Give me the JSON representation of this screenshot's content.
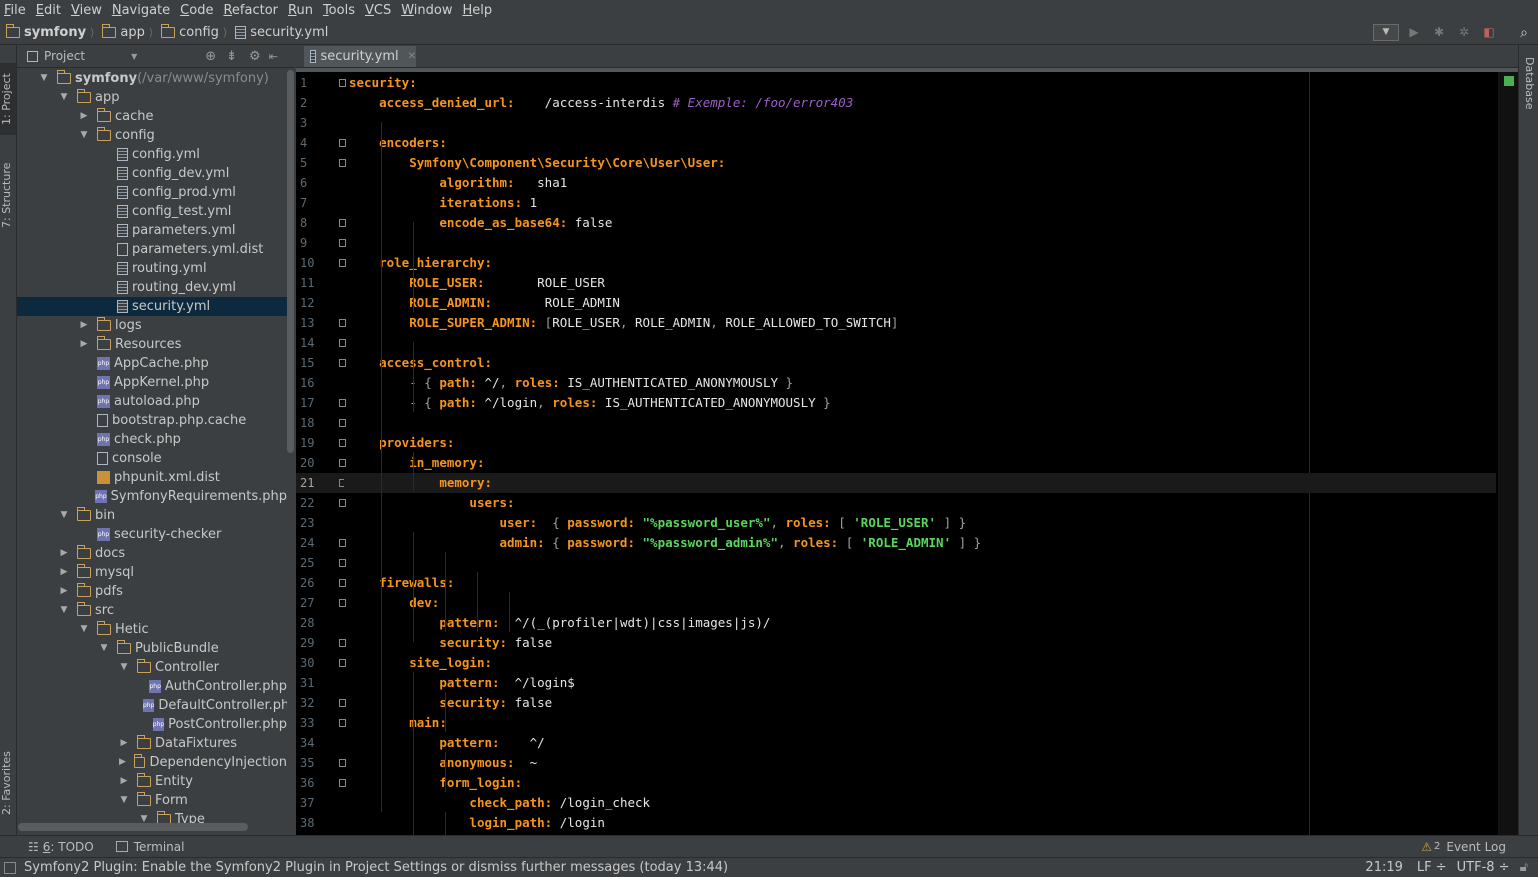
{
  "menu": {
    "items": [
      {
        "u": "F",
        "rest": "ile"
      },
      {
        "u": "E",
        "rest": "dit"
      },
      {
        "u": "V",
        "rest": "iew"
      },
      {
        "u": "N",
        "rest": "avigate"
      },
      {
        "u": "C",
        "rest": "ode"
      },
      {
        "u": "R",
        "rest": "efactor"
      },
      {
        "u": "R",
        "rest": "un"
      },
      {
        "u": "T",
        "rest": "ools"
      },
      {
        "u": "V",
        "rest": "CS"
      },
      {
        "u": "W",
        "rest": "indow"
      },
      {
        "u": "H",
        "rest": "elp"
      }
    ]
  },
  "breadcrumb": [
    "symfony",
    "app",
    "config",
    "security.yml"
  ],
  "left_strip": {
    "project": "1: Project",
    "structure": "7: Structure",
    "favorites": "2: Favorites"
  },
  "right_strip": {
    "database": "Database"
  },
  "project_panel": {
    "title": "Project",
    "tree": [
      {
        "label": "symfony",
        "extra": " (/var/www/symfony)",
        "icon": "folder",
        "arrow": "down",
        "depth": 0,
        "bold": true
      },
      {
        "label": "app",
        "icon": "folder",
        "arrow": "down",
        "depth": 1
      },
      {
        "label": "cache",
        "icon": "folder",
        "arrow": "right",
        "depth": 2
      },
      {
        "label": "config",
        "icon": "folder",
        "arrow": "down",
        "depth": 2
      },
      {
        "label": "config.yml",
        "icon": "yml",
        "depth": 3
      },
      {
        "label": "config_dev.yml",
        "icon": "yml",
        "depth": 3
      },
      {
        "label": "config_prod.yml",
        "icon": "yml",
        "depth": 3
      },
      {
        "label": "config_test.yml",
        "icon": "yml",
        "depth": 3
      },
      {
        "label": "parameters.yml",
        "icon": "yml",
        "depth": 3
      },
      {
        "label": "parameters.yml.dist",
        "icon": "txt",
        "depth": 3
      },
      {
        "label": "routing.yml",
        "icon": "yml",
        "depth": 3
      },
      {
        "label": "routing_dev.yml",
        "icon": "yml",
        "depth": 3
      },
      {
        "label": "security.yml",
        "icon": "yml",
        "depth": 3,
        "selected": true
      },
      {
        "label": "logs",
        "icon": "folder",
        "arrow": "right",
        "depth": 2
      },
      {
        "label": "Resources",
        "icon": "folder",
        "arrow": "right",
        "depth": 2
      },
      {
        "label": "AppCache.php",
        "icon": "php",
        "depth": 2
      },
      {
        "label": "AppKernel.php",
        "icon": "php",
        "depth": 2
      },
      {
        "label": "autoload.php",
        "icon": "php",
        "depth": 2
      },
      {
        "label": "bootstrap.php.cache",
        "icon": "txt",
        "depth": 2
      },
      {
        "label": "check.php",
        "icon": "php",
        "depth": 2
      },
      {
        "label": "console",
        "icon": "txt",
        "depth": 2
      },
      {
        "label": "phpunit.xml.dist",
        "icon": "xml",
        "depth": 2
      },
      {
        "label": "SymfonyRequirements.php",
        "icon": "php",
        "depth": 2
      },
      {
        "label": "bin",
        "icon": "folder",
        "arrow": "down",
        "depth": 1
      },
      {
        "label": "security-checker",
        "icon": "php",
        "depth": 2
      },
      {
        "label": "docs",
        "icon": "folder",
        "arrow": "right",
        "depth": 1
      },
      {
        "label": "mysql",
        "icon": "folder",
        "arrow": "right",
        "depth": 1
      },
      {
        "label": "pdfs",
        "icon": "folder",
        "arrow": "right",
        "depth": 1
      },
      {
        "label": "src",
        "icon": "folder",
        "arrow": "down",
        "depth": 1
      },
      {
        "label": "Hetic",
        "icon": "folder",
        "arrow": "down",
        "depth": 2
      },
      {
        "label": "PublicBundle",
        "icon": "folder",
        "arrow": "down",
        "depth": 3
      },
      {
        "label": "Controller",
        "icon": "folder",
        "arrow": "down",
        "depth": 4
      },
      {
        "label": "AuthController.php",
        "icon": "php",
        "depth": 5
      },
      {
        "label": "DefaultController.ph",
        "icon": "php",
        "depth": 5
      },
      {
        "label": "PostController.php",
        "icon": "php",
        "depth": 5
      },
      {
        "label": "DataFixtures",
        "icon": "folder",
        "arrow": "right",
        "depth": 4
      },
      {
        "label": "DependencyInjection",
        "icon": "folder",
        "arrow": "right",
        "depth": 4
      },
      {
        "label": "Entity",
        "icon": "folder",
        "arrow": "right",
        "depth": 4
      },
      {
        "label": "Form",
        "icon": "folder",
        "arrow": "down",
        "depth": 4
      },
      {
        "label": "Type",
        "icon": "folder",
        "arrow": "down",
        "depth": 5
      }
    ]
  },
  "editor": {
    "tab_label": "security.yml",
    "current_line": 21,
    "lines": [
      [
        [
          "k",
          "security:"
        ]
      ],
      [
        [
          "p",
          "    "
        ],
        [
          "k",
          "access_denied_url:"
        ],
        [
          "v",
          "    /access-interdis "
        ],
        [
          "c",
          "# Exemple: /foo/error403"
        ]
      ],
      [],
      [
        [
          "p",
          "    "
        ],
        [
          "k",
          "encoders:"
        ]
      ],
      [
        [
          "p",
          "        "
        ],
        [
          "k",
          "Symfony\\Component\\Security\\Core\\User\\User:"
        ]
      ],
      [
        [
          "p",
          "            "
        ],
        [
          "k",
          "algorithm:"
        ],
        [
          "v",
          "   sha1"
        ]
      ],
      [
        [
          "p",
          "            "
        ],
        [
          "k",
          "iterations:"
        ],
        [
          "v",
          " 1"
        ]
      ],
      [
        [
          "p",
          "            "
        ],
        [
          "k",
          "encode_as_base64:"
        ],
        [
          "v",
          " false"
        ]
      ],
      [],
      [
        [
          "p",
          "    "
        ],
        [
          "k",
          "role_hierarchy:"
        ]
      ],
      [
        [
          "p",
          "        "
        ],
        [
          "k",
          "ROLE_USER:"
        ],
        [
          "v",
          "       ROLE_USER"
        ]
      ],
      [
        [
          "p",
          "        "
        ],
        [
          "k",
          "ROLE_ADMIN:"
        ],
        [
          "v",
          "       ROLE_ADMIN"
        ]
      ],
      [
        [
          "p",
          "        "
        ],
        [
          "k",
          "ROLE_SUPER_ADMIN:"
        ],
        [
          "p",
          " ["
        ],
        [
          "v",
          "ROLE_USER"
        ],
        [
          "p",
          ", "
        ],
        [
          "v",
          "ROLE_ADMIN"
        ],
        [
          "p",
          ", "
        ],
        [
          "v",
          "ROLE_ALLOWED_TO_SWITCH"
        ],
        [
          "p",
          "]"
        ]
      ],
      [],
      [
        [
          "p",
          "    "
        ],
        [
          "k",
          "access_control:"
        ]
      ],
      [
        [
          "p",
          "        - { "
        ],
        [
          "k",
          "path:"
        ],
        [
          "v",
          " ^/"
        ],
        [
          "p",
          ", "
        ],
        [
          "k",
          "roles:"
        ],
        [
          "v",
          " IS_AUTHENTICATED_ANONYMOUSLY"
        ],
        [
          "p",
          " }"
        ]
      ],
      [
        [
          "p",
          "        - { "
        ],
        [
          "k",
          "path:"
        ],
        [
          "v",
          " ^/login"
        ],
        [
          "p",
          ", "
        ],
        [
          "k",
          "roles:"
        ],
        [
          "v",
          " IS_AUTHENTICATED_ANONYMOUSLY"
        ],
        [
          "p",
          " }"
        ]
      ],
      [],
      [
        [
          "p",
          "    "
        ],
        [
          "k",
          "providers:"
        ]
      ],
      [
        [
          "p",
          "        "
        ],
        [
          "k",
          "in_memory:"
        ]
      ],
      [
        [
          "p",
          "            "
        ],
        [
          "k",
          "memory:"
        ]
      ],
      [
        [
          "p",
          "                "
        ],
        [
          "k",
          "users:"
        ]
      ],
      [
        [
          "p",
          "                    "
        ],
        [
          "k",
          "user:"
        ],
        [
          "p",
          "  { "
        ],
        [
          "k",
          "password:"
        ],
        [
          "v",
          " "
        ],
        [
          "s",
          "\"%password_user%\""
        ],
        [
          "p",
          ", "
        ],
        [
          "k",
          "roles:"
        ],
        [
          "p",
          " [ "
        ],
        [
          "s",
          "'ROLE_USER'"
        ],
        [
          "p",
          " ] }"
        ]
      ],
      [
        [
          "p",
          "                    "
        ],
        [
          "k",
          "admin:"
        ],
        [
          "p",
          " { "
        ],
        [
          "k",
          "password:"
        ],
        [
          "v",
          " "
        ],
        [
          "s",
          "\"%password_admin%\""
        ],
        [
          "p",
          ", "
        ],
        [
          "k",
          "roles:"
        ],
        [
          "p",
          " [ "
        ],
        [
          "s",
          "'ROLE_ADMIN'"
        ],
        [
          "p",
          " ] }"
        ]
      ],
      [],
      [
        [
          "p",
          "    "
        ],
        [
          "k",
          "firewalls:"
        ]
      ],
      [
        [
          "p",
          "        "
        ],
        [
          "k",
          "dev:"
        ]
      ],
      [
        [
          "p",
          "            "
        ],
        [
          "k",
          "pattern:"
        ],
        [
          "v",
          "  ^/(_(profiler|wdt)|css|images|js)/"
        ]
      ],
      [
        [
          "p",
          "            "
        ],
        [
          "k",
          "security:"
        ],
        [
          "v",
          " false"
        ]
      ],
      [
        [
          "p",
          "        "
        ],
        [
          "k",
          "site_login:"
        ]
      ],
      [
        [
          "p",
          "            "
        ],
        [
          "k",
          "pattern:"
        ],
        [
          "v",
          "  ^/login$"
        ]
      ],
      [
        [
          "p",
          "            "
        ],
        [
          "k",
          "security:"
        ],
        [
          "v",
          " false"
        ]
      ],
      [
        [
          "p",
          "        "
        ],
        [
          "k",
          "main:"
        ]
      ],
      [
        [
          "p",
          "            "
        ],
        [
          "k",
          "pattern:"
        ],
        [
          "v",
          "    ^/"
        ]
      ],
      [
        [
          "p",
          "            "
        ],
        [
          "k",
          "anonymous:"
        ],
        [
          "v",
          "  ~"
        ]
      ],
      [
        [
          "p",
          "            "
        ],
        [
          "k",
          "form_login:"
        ]
      ],
      [
        [
          "p",
          "                "
        ],
        [
          "k",
          "check_path:"
        ],
        [
          "v",
          " /login_check"
        ]
      ],
      [
        [
          "p",
          "                "
        ],
        [
          "k",
          "login_path:"
        ],
        [
          "v",
          " /login"
        ]
      ]
    ]
  },
  "bottom_tools": {
    "todo_num": "6",
    "todo_label": ": TODO",
    "terminal": "Terminal",
    "event_log": "Event Log",
    "event_count": "2"
  },
  "status": {
    "message": "Symfony2 Plugin: Enable the Symfony2 Plugin in Project Settings or dismiss further messages (today 13:44)",
    "position": "21:19",
    "line_sep": "LF ÷",
    "encoding": "UTF-8 ÷"
  },
  "colors": {
    "key": "#f7941d",
    "string": "#59d65d",
    "comment": "#9b5fc9",
    "value": "#e6e6e6",
    "background": "#000000",
    "selection": "#0d293e"
  }
}
